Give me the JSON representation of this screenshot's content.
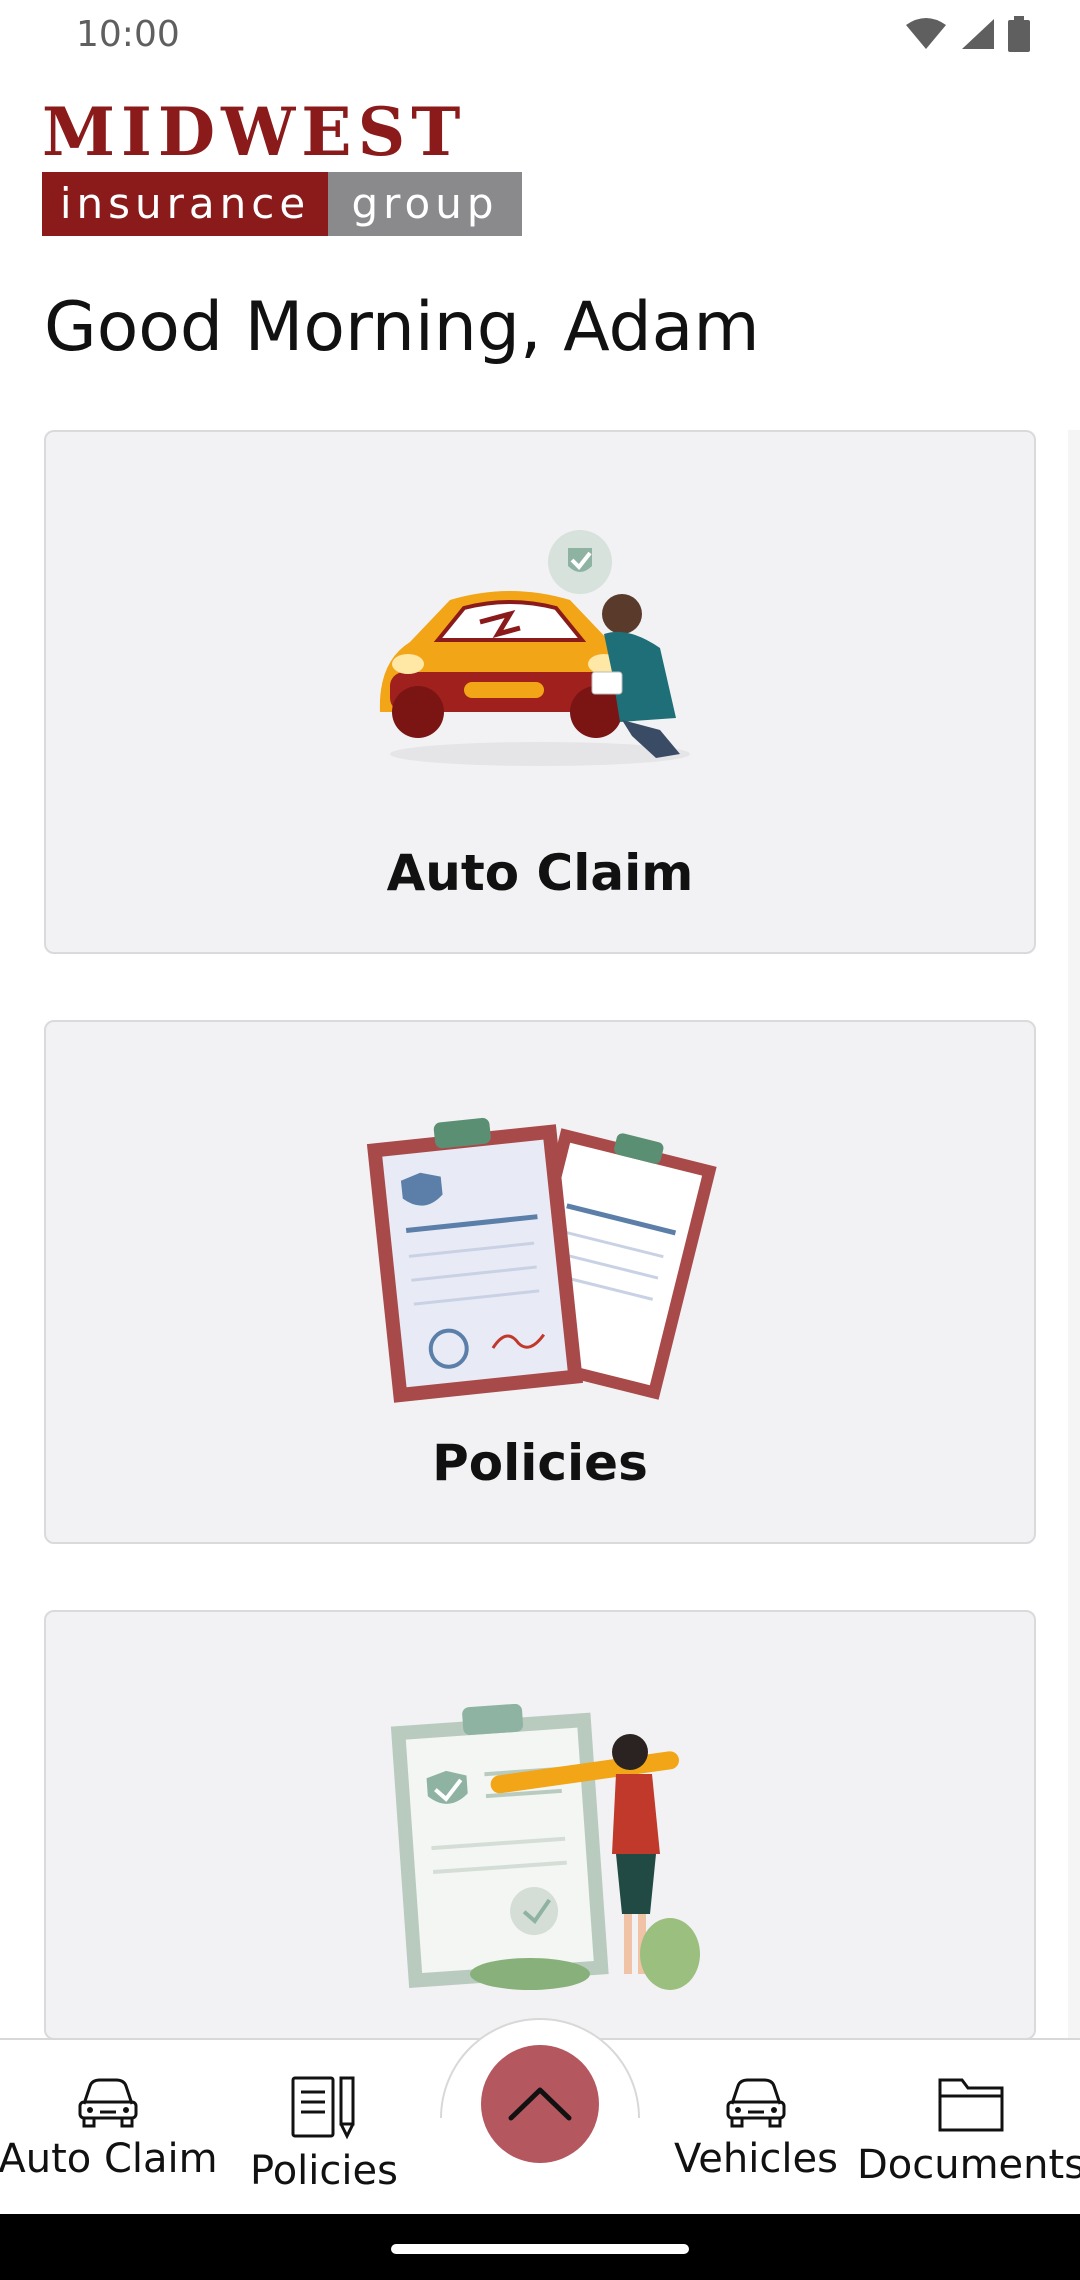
{
  "status_bar": {
    "time": "10:00",
    "icons": [
      "wifi-icon",
      "signal-icon",
      "battery-icon"
    ]
  },
  "logo": {
    "line1": "MIDWEST",
    "line2_left": "insurance",
    "line2_right": "group",
    "colors": {
      "brand_red": "#8b1a1a",
      "brand_gray": "#8a8a8c"
    }
  },
  "greeting": "Good Morning, Adam",
  "cards": [
    {
      "label": "Auto Claim",
      "illustration": "car-inspection-illustration"
    },
    {
      "label": "Policies",
      "illustration": "insurance-policy-illustration"
    },
    {
      "label": "",
      "illustration": "checklist-illustration"
    }
  ],
  "bottom_nav": {
    "items": [
      {
        "label": "Auto Claim",
        "icon": "car-icon"
      },
      {
        "label": "Policies",
        "icon": "document-pen-icon"
      },
      {
        "label": "Vehicles",
        "icon": "car-icon"
      },
      {
        "label": "Documents",
        "icon": "folder-icon"
      }
    ],
    "fab_icon": "chevron-up-icon",
    "fab_color": "#b5575f"
  }
}
